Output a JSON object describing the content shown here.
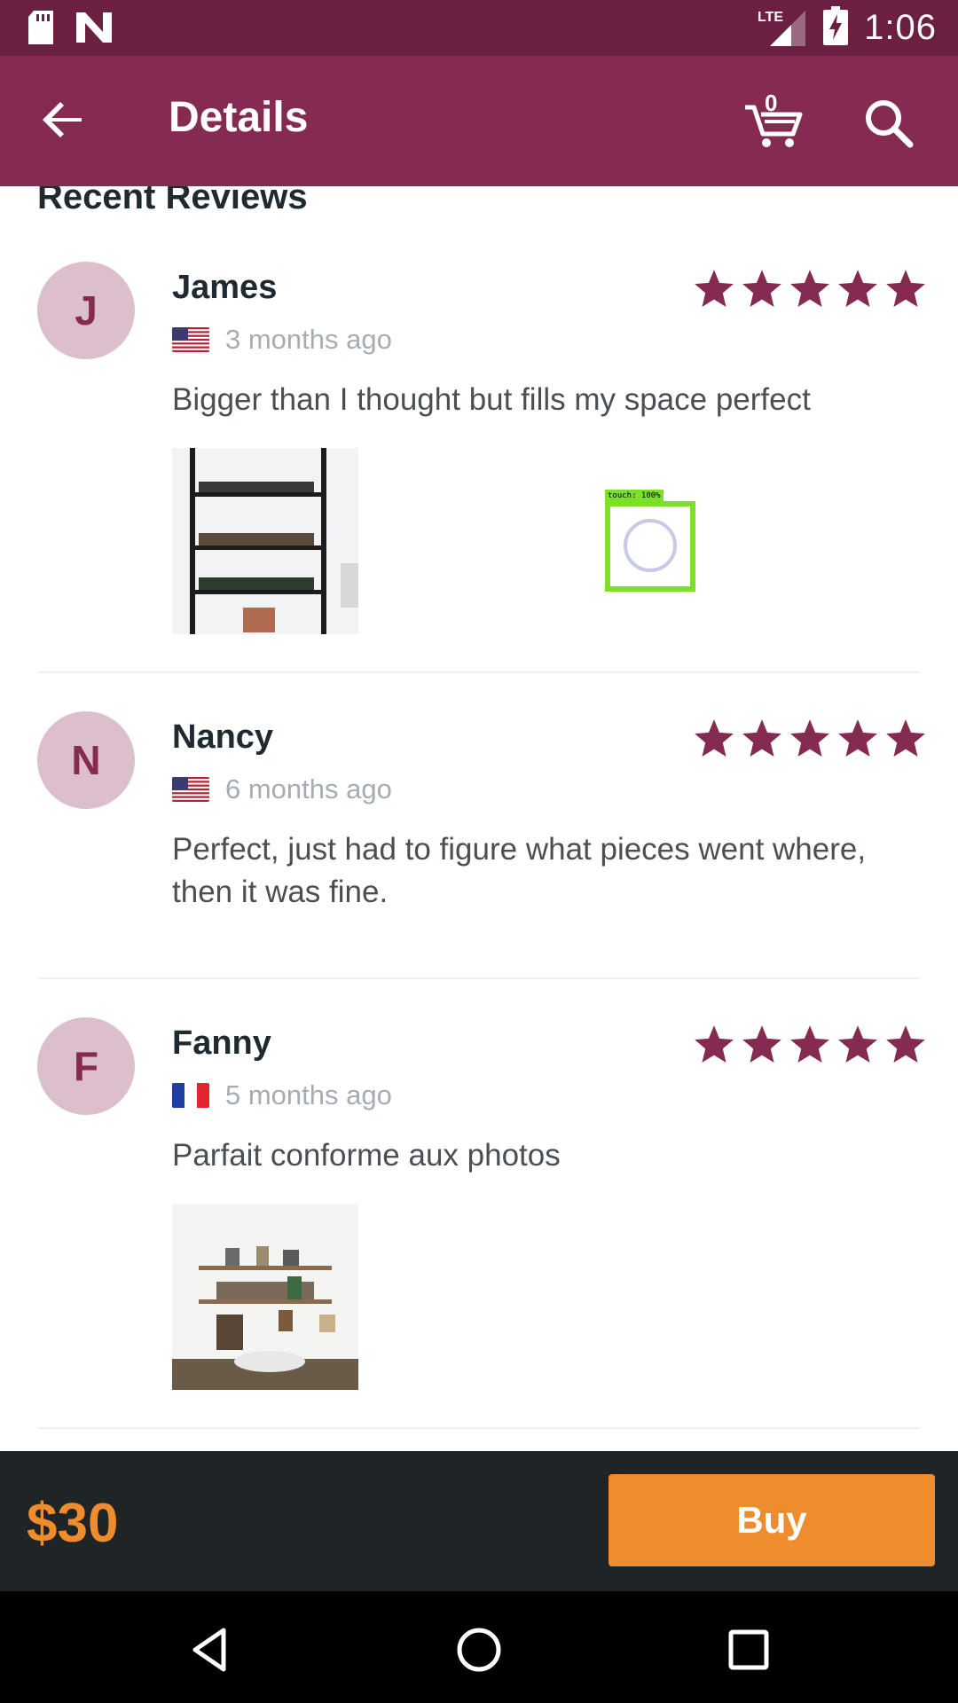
{
  "status_bar": {
    "time": "1:06",
    "network": "LTE"
  },
  "app_bar": {
    "title": "Details",
    "cart_count": "0"
  },
  "reviews_section": {
    "title": "Recent Reviews"
  },
  "reviews": [
    {
      "initial": "J",
      "name": "James",
      "date": "3 months ago",
      "country": "us",
      "rating": 5,
      "text": "Bigger than I thought but fills my space perfect",
      "has_photo": true
    },
    {
      "initial": "N",
      "name": "Nancy",
      "date": "6 months ago",
      "country": "us",
      "rating": 5,
      "text": "Perfect, just had to figure what pieces went where, then it was fine.",
      "has_photo": false
    },
    {
      "initial": "F",
      "name": "Fanny",
      "date": "5 months ago",
      "country": "fr",
      "rating": 5,
      "text": "Parfait conforme aux photos",
      "has_photo": true
    }
  ],
  "touch_indicator": {
    "label": "touch: 100%"
  },
  "footer": {
    "price": "$30",
    "buy_label": "Buy"
  },
  "colors": {
    "primary": "#852b52",
    "status_bar": "#6b1f41",
    "accent": "#ef8c2e",
    "star": "#852b52",
    "avatar_bg": "#dcbfcd"
  },
  "icons": [
    "sd-card-icon",
    "n-icon",
    "lte-signal-icon",
    "battery-charging-icon",
    "back-arrow-icon",
    "cart-icon",
    "search-icon",
    "star-icon",
    "flag-us-icon",
    "flag-fr-icon",
    "nav-back-icon",
    "nav-home-icon",
    "nav-recents-icon"
  ]
}
